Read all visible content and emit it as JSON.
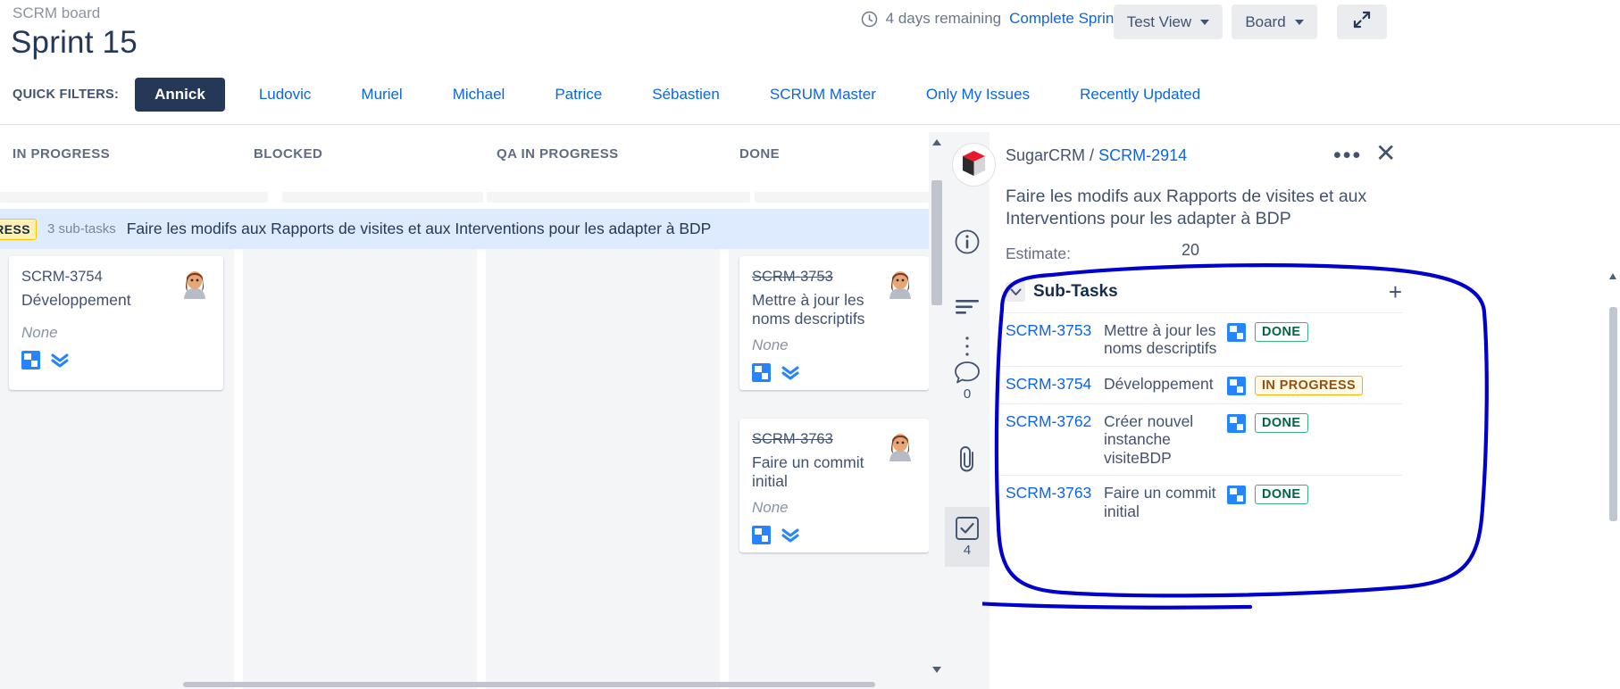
{
  "header": {
    "breadcrumb": "SCRM board",
    "title": "Sprint 15",
    "days_remaining": "4 days remaining",
    "complete_sprint": "Complete Sprint",
    "view_button": "Test View",
    "board_button": "Board",
    "clock_icon": "clock-icon",
    "expand_icon": "expand-icon"
  },
  "quick_filters": {
    "label": "QUICK FILTERS:",
    "items": [
      {
        "label": "Annick",
        "active": true
      },
      {
        "label": "Ludovic",
        "active": false
      },
      {
        "label": "Muriel",
        "active": false
      },
      {
        "label": "Michael",
        "active": false
      },
      {
        "label": "Patrice",
        "active": false
      },
      {
        "label": "Sébastien",
        "active": false
      },
      {
        "label": "SCRUM Master",
        "active": false
      },
      {
        "label": "Only My Issues",
        "active": false
      },
      {
        "label": "Recently Updated",
        "active": false
      }
    ]
  },
  "board": {
    "columns": [
      {
        "title": "IN PROGRESS"
      },
      {
        "title": "BLOCKED"
      },
      {
        "title": "QA IN PROGRESS"
      },
      {
        "title": "DONE"
      }
    ],
    "swimlane": {
      "status": "GRESS",
      "subtask_count": "3 sub-tasks",
      "summary": "Faire les modifs aux Rapports de visites et aux Interventions pour les adapter à BDP"
    },
    "cards": [
      {
        "column": "IN PROGRESS",
        "key": "SCRM-3754",
        "summary": "Développement",
        "epic": "None",
        "done": false,
        "type_icon": "subtask-icon",
        "priority_icon": "priority-lowest-icon",
        "avatar": "avatar-annick"
      },
      {
        "column": "DONE",
        "key": "SCRM-3753",
        "summary": "Mettre à jour les noms descriptifs",
        "epic": "None",
        "done": true,
        "type_icon": "subtask-icon",
        "priority_icon": "priority-lowest-icon",
        "avatar": "avatar-annick"
      },
      {
        "column": "DONE",
        "key": "SCRM-3763",
        "summary": "Faire un commit initial",
        "epic": "None",
        "done": true,
        "type_icon": "subtask-icon",
        "priority_icon": "priority-lowest-icon",
        "avatar": "avatar-annick"
      }
    ]
  },
  "detail": {
    "project": "SugarCRM",
    "separator": "/",
    "issue_key": "SCRM-2914",
    "title": "Faire les modifs aux Rapports de visites et aux Interventions pour les adapter à BDP",
    "estimate_label": "Estimate:",
    "estimate_value": "20",
    "more_icon": "more-options-icon",
    "close_icon": "close-icon",
    "logo_icon": "app-logo-icon",
    "rail": [
      {
        "icon": "info-icon",
        "count": ""
      },
      {
        "icon": "description-icon",
        "count": ""
      },
      {
        "icon": "drag-handle-icon",
        "count": ""
      },
      {
        "icon": "comment-icon",
        "count": "0"
      },
      {
        "icon": "attachment-icon",
        "count": ""
      },
      {
        "icon": "checklist-icon",
        "count": "4"
      }
    ],
    "subtasks": {
      "heading": "Sub-Tasks",
      "chevron_icon": "chevron-down-icon",
      "add_icon": "plus-icon",
      "rows": [
        {
          "key": "SCRM-3753",
          "summary": "Mettre à jour les noms descriptifs",
          "type_icon": "subtask-icon",
          "status": "DONE",
          "status_kind": "done"
        },
        {
          "key": "SCRM-3754",
          "summary": "Développement",
          "type_icon": "subtask-icon",
          "status": "IN PROGRESS",
          "status_kind": "inprogress"
        },
        {
          "key": "SCRM-3762",
          "summary": "Créer nouvel instanche visiteBDP",
          "type_icon": "subtask-icon",
          "status": "DONE",
          "status_kind": "done"
        },
        {
          "key": "SCRM-3763",
          "summary": "Faire un commit initial",
          "type_icon": "subtask-icon",
          "status": "DONE",
          "status_kind": "done"
        }
      ]
    }
  },
  "colors": {
    "link": "#0c66e4",
    "active_filter_bg": "#253858",
    "swimlane_bg": "#deebff",
    "column_bg": "#f4f5f7",
    "done_badge": "#36b37e",
    "inprogress_badge": "#ffab00",
    "annotation": "#0000cc"
  }
}
